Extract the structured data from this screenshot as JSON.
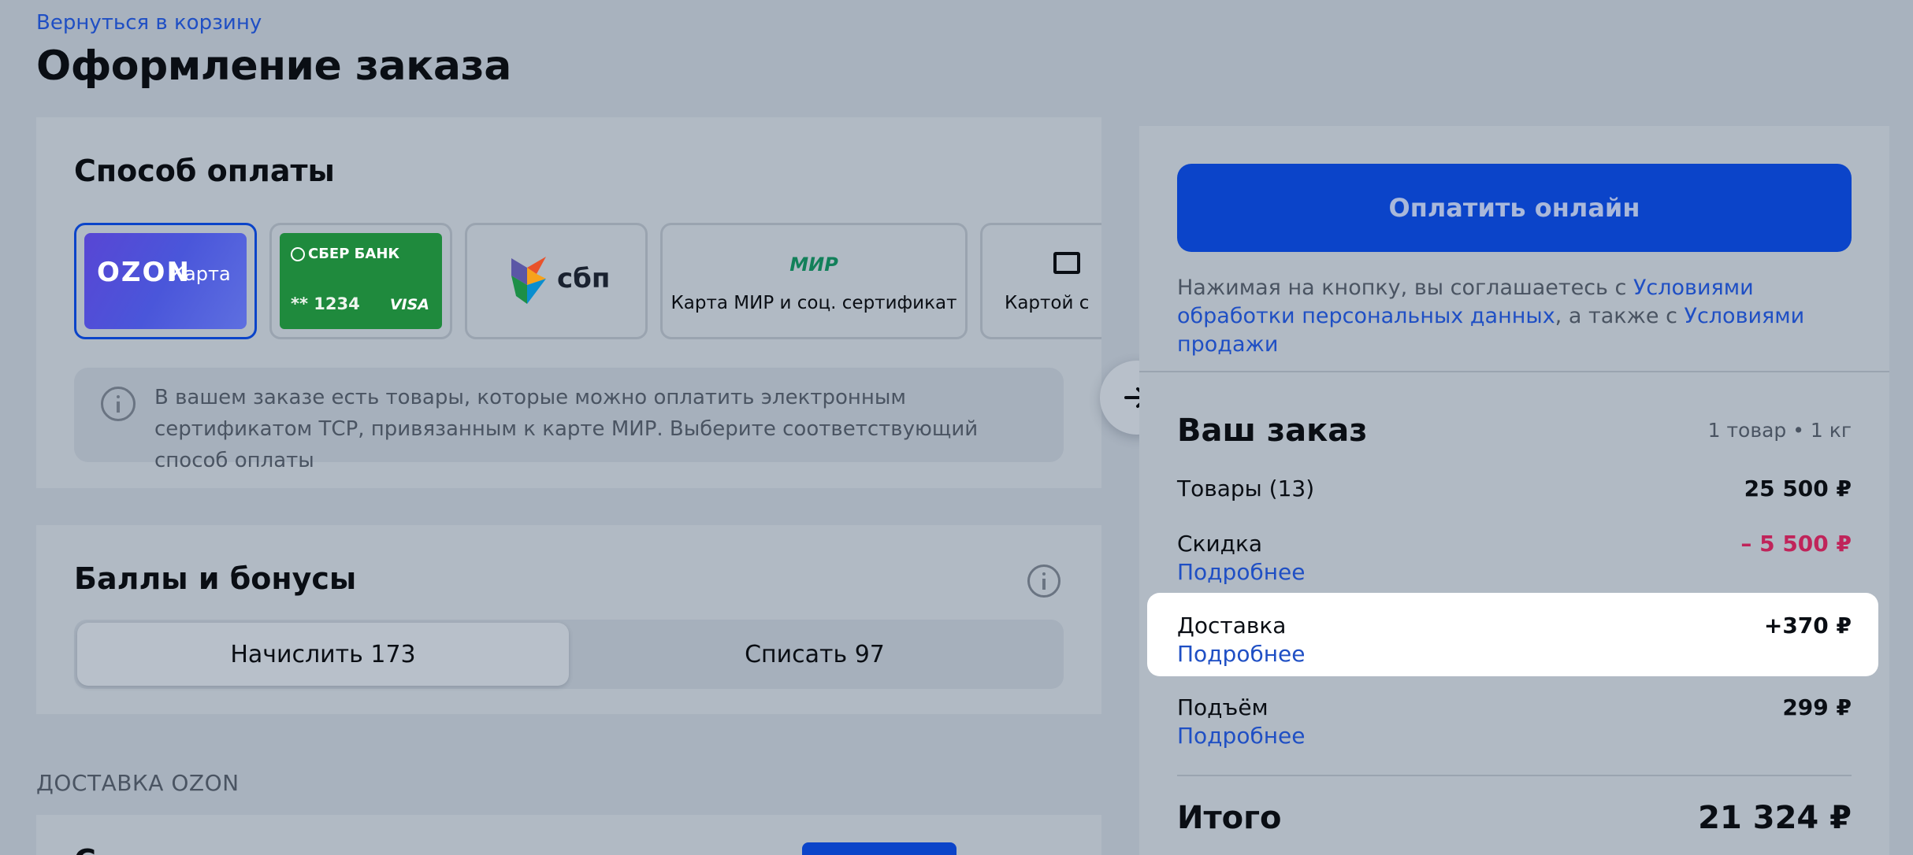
{
  "header": {
    "back_link": "Вернуться в корзину",
    "title": "Оформление заказа"
  },
  "payment": {
    "title": "Способ оплаты",
    "methods": [
      {
        "logo": "OZON",
        "sublabel": "Карта",
        "selected": true
      },
      {
        "bank": "СБЕР БАНК",
        "number": "** 1234",
        "network": "VISA",
        "selected": false
      },
      {
        "logo": "сбп",
        "selected": false
      },
      {
        "logo": "МИР",
        "label": "Карта МИР и соц. сертификат",
        "selected": false
      },
      {
        "label": "Картой с",
        "selected": false
      }
    ],
    "info_text": "В вашем заказе есть товары, которые можно оплатить электронным сертификатом ТСР, привязанным к карте МИР.  Выберите соответствующий способ оплаты"
  },
  "bonuses": {
    "title": "Баллы и бонусы",
    "options": [
      "Начислить 173",
      "Списать 97"
    ],
    "active_index": 0
  },
  "delivery": {
    "section_label": "ДОСТАВКА OZON"
  },
  "summary": {
    "pay_button": "Оплатить онлайн",
    "consent": {
      "prefix": "Нажимая на кнопку, вы соглашаетесь с ",
      "link1": "Условиями обработки персональных данных",
      "middle": ", а также с ",
      "link2": "Условиями продажи"
    },
    "order_title": "Ваш заказ",
    "order_meta": "1 товар • 1 кг",
    "rows": [
      {
        "label": "Товары (13)",
        "value": "25 500 ₽"
      },
      {
        "label": "Скидка",
        "value": "– 5 500 ₽",
        "link": "Подробнее"
      },
      {
        "label": "Доставка",
        "value": "+370 ₽",
        "link": "Подробнее",
        "highlighted": true
      },
      {
        "label": "Подъём",
        "value": "299 ₽",
        "link": "Подробнее"
      }
    ],
    "total_label": "Итого",
    "total_value": "21 324 ₽"
  },
  "colors": {
    "accent": "#0b44c9",
    "link": "#1f4fc4",
    "discount": "#c0245a",
    "sber_green": "#1f8a3d",
    "ozon_purple": "#5846d4"
  },
  "icons": [
    "sber-check-icon",
    "sbp-logo-icon",
    "card-icon",
    "arrow-right-icon",
    "info-icon"
  ]
}
